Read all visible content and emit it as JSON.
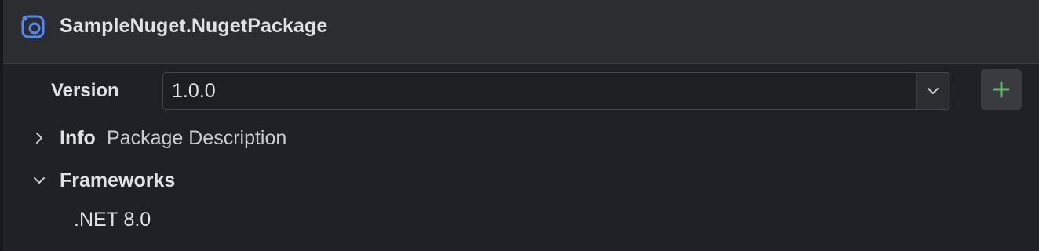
{
  "header": {
    "icon": "nuget-package-icon",
    "title": "SampleNuget.NugetPackage"
  },
  "version": {
    "label": "Version",
    "selected": "1.0.0",
    "add_button_icon": "plus-icon"
  },
  "tree": {
    "info": {
      "title": "Info",
      "description": "Package Description",
      "expanded": false
    },
    "frameworks": {
      "title": "Frameworks",
      "expanded": true,
      "items": [
        ".NET 8.0"
      ]
    }
  },
  "colors": {
    "accent_blue": "#548af7",
    "add_green": "#5fb865"
  }
}
